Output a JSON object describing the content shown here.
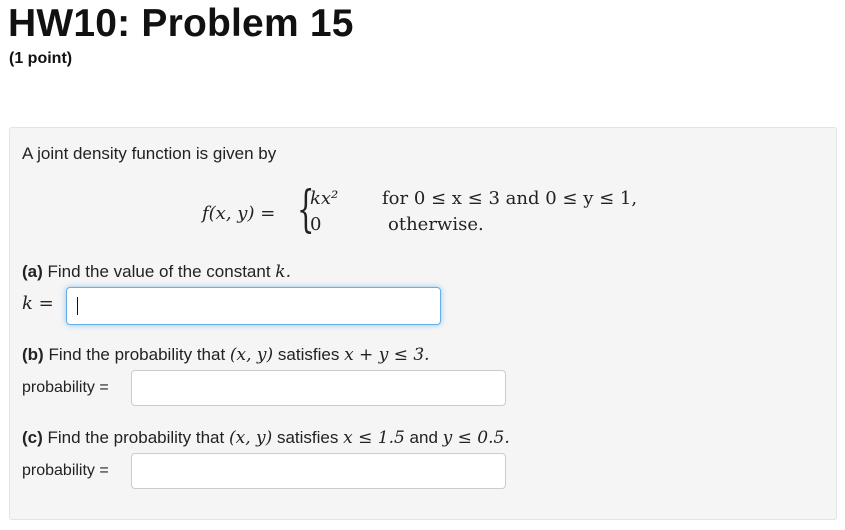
{
  "header": {
    "title": "HW10: Problem 15",
    "points": "(1 point)"
  },
  "problem": {
    "intro": "A joint density function is given by",
    "function_lhs": "f(x, y) =",
    "case1_value": "kx²",
    "case1_condition": "for 0 ≤ x ≤ 3 and 0 ≤ y ≤ 1,",
    "case2_value": "0",
    "case2_condition": "otherwise."
  },
  "parts": [
    {
      "tag": "(a)",
      "text": "Find the value of the constant",
      "math": "k.",
      "answer_label": "k =",
      "value": ""
    },
    {
      "tag": "(b)",
      "text_before": "Find the probability that",
      "math1": "(x, y)",
      "text_mid": "satisfies",
      "math2": "x + y ≤ 3.",
      "answer_label": "probability =",
      "value": ""
    },
    {
      "tag": "(c)",
      "text_before": "Find the probability that",
      "math1": "(x, y)",
      "text_mid": "satisfies",
      "math2": "x ≤ 1.5",
      "text_and": "and",
      "math3": "y ≤ 0.5.",
      "answer_label": "probability =",
      "value": ""
    }
  ]
}
